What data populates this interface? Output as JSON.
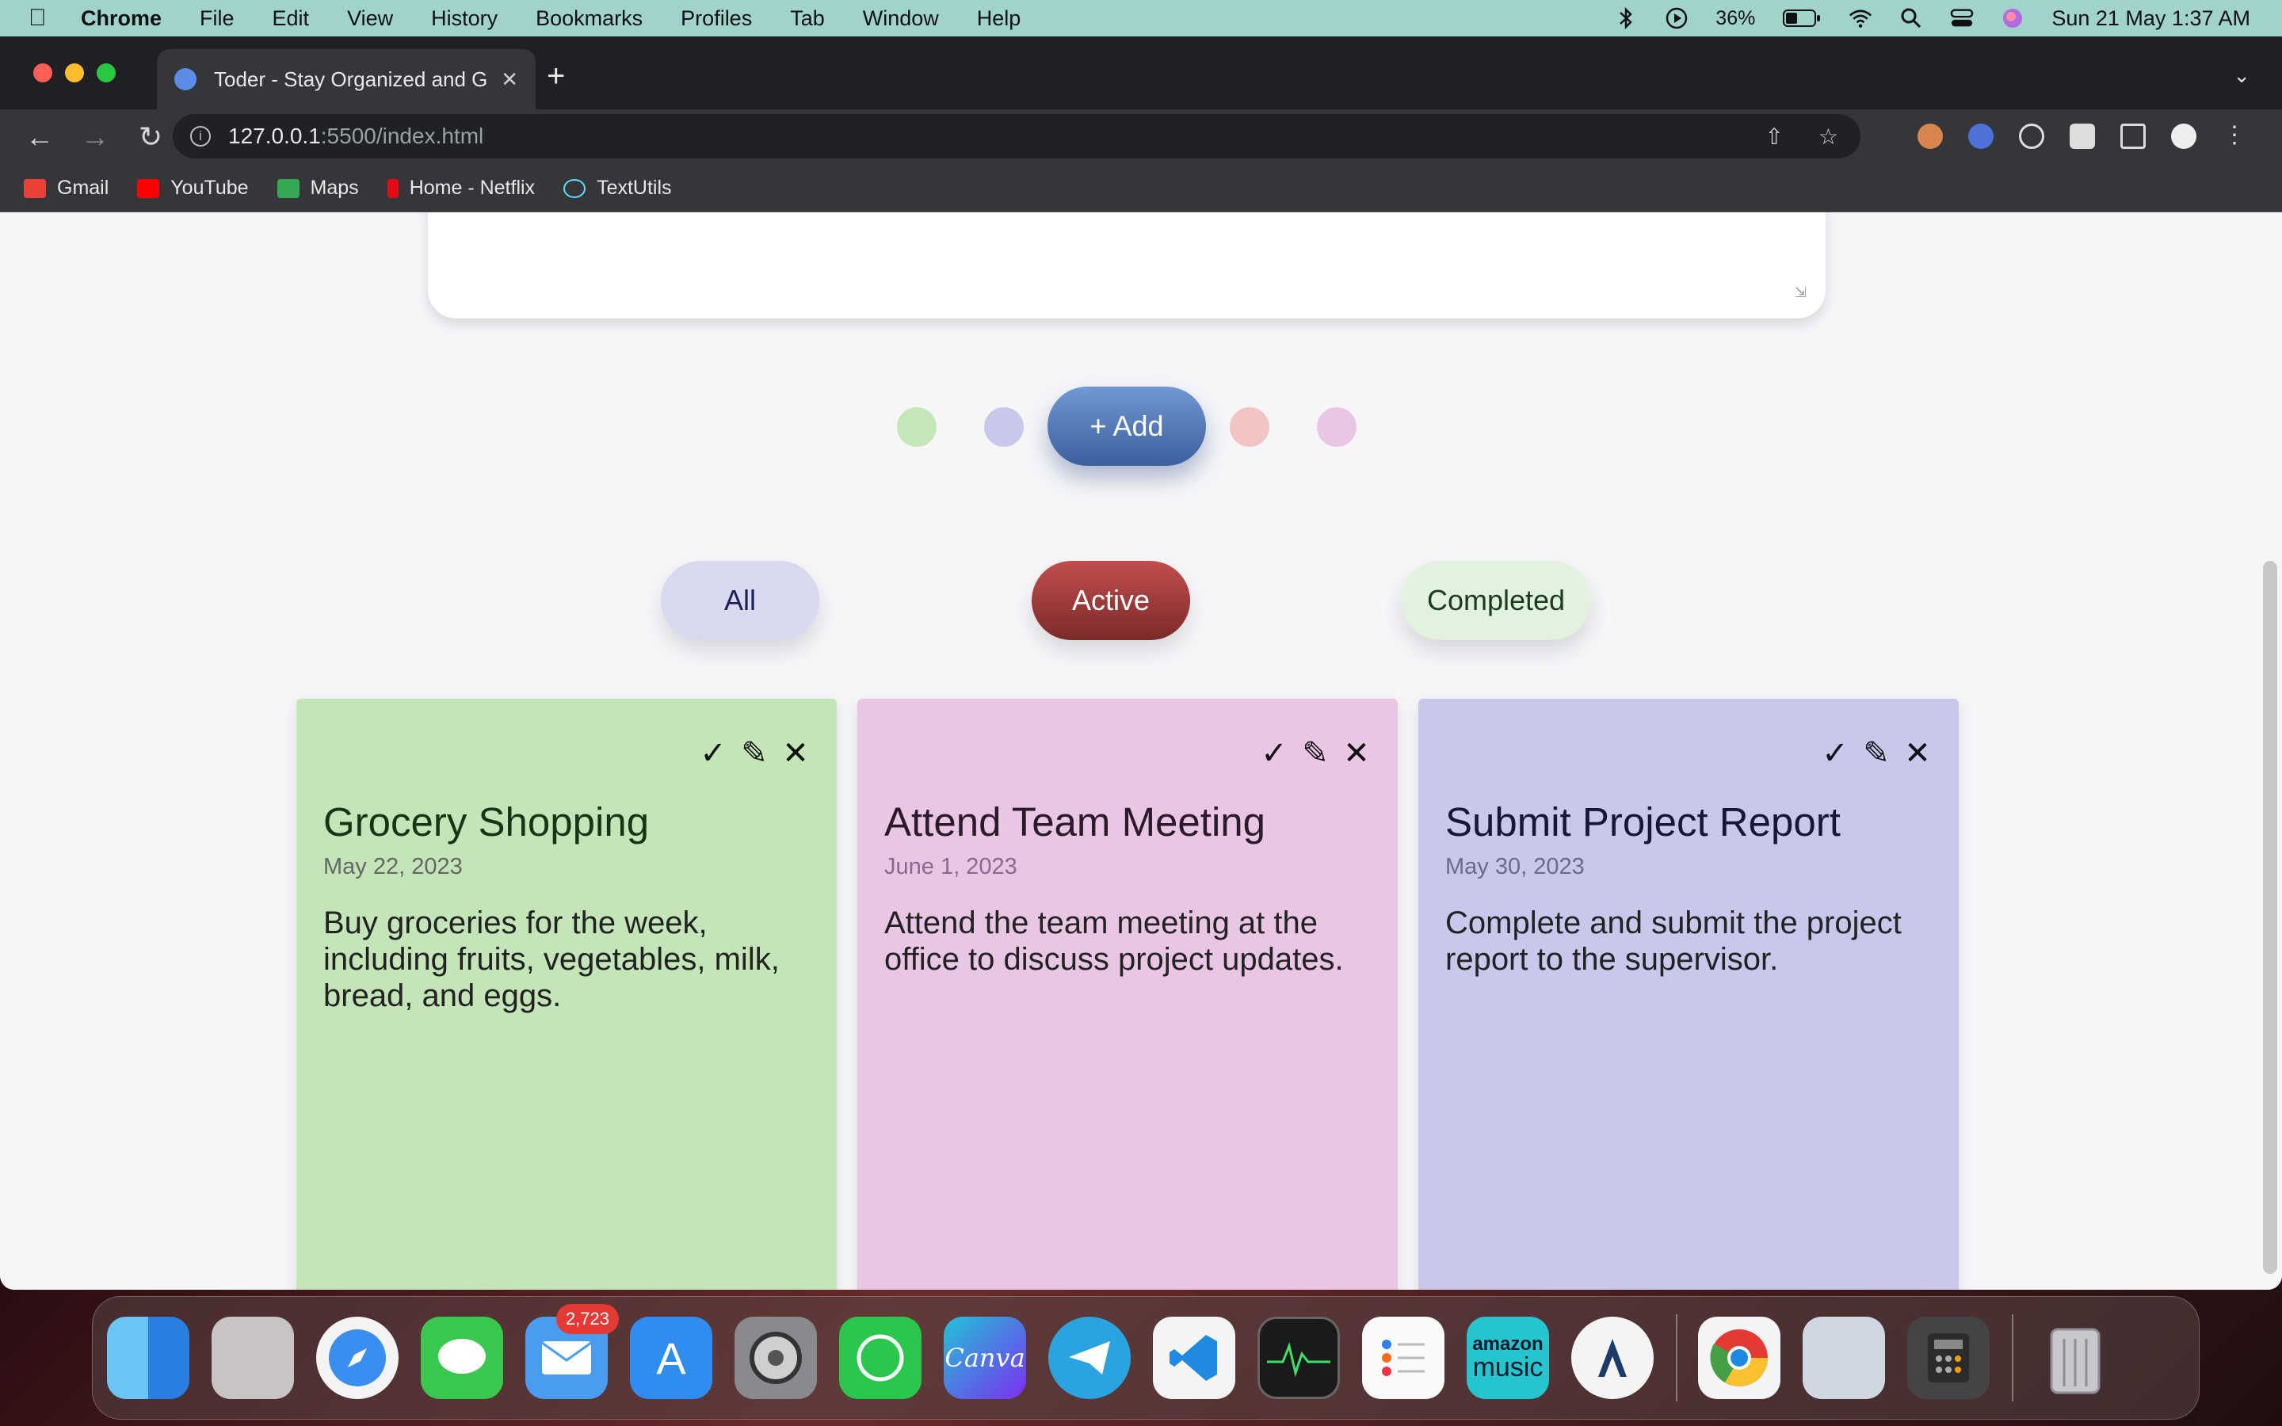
{
  "menubar": {
    "app": "Chrome",
    "items": [
      "File",
      "Edit",
      "View",
      "History",
      "Bookmarks",
      "Profiles",
      "Tab",
      "Window",
      "Help"
    ],
    "battery": "36%",
    "datetime": "Sun 21 May  1:37 AM"
  },
  "browser": {
    "tab_title": "Toder - Stay Organized and Ge",
    "url_host": "127.0.0.1",
    "url_rest": ":5500/index.html",
    "bookmarks": [
      {
        "label": "Gmail",
        "color": "#ea4335"
      },
      {
        "label": "YouTube",
        "color": "#ff0000"
      },
      {
        "label": "Maps",
        "color": "#34a853"
      },
      {
        "label": "Home - Netflix",
        "color": "#e50914"
      },
      {
        "label": "TextUtils",
        "color": "#61dafb"
      }
    ]
  },
  "page": {
    "add_label": "+ Add",
    "color_dots": [
      "#c5e6b9",
      "#c9c8ec",
      "#f3c4c4",
      "#e8c6e4"
    ],
    "filters": {
      "all": "All",
      "active": "Active",
      "completed": "Completed"
    },
    "notes": [
      {
        "title": "Grocery Shopping",
        "date": "May 22, 2023",
        "description": "Buy groceries for the week, including fruits, vegetables, milk, bread, and eggs."
      },
      {
        "title": "Attend Team Meeting",
        "date": "June 1, 2023",
        "description": "Attend the team meeting at the office to discuss project updates."
      },
      {
        "title": "Submit Project Report",
        "date": "May 30, 2023",
        "description": "Complete and submit the project report to the supervisor."
      }
    ]
  },
  "dock": {
    "mail_badge": "2,723",
    "canva_label": "Canva",
    "amazon_label_1": "amazon",
    "amazon_label_2": "music"
  }
}
